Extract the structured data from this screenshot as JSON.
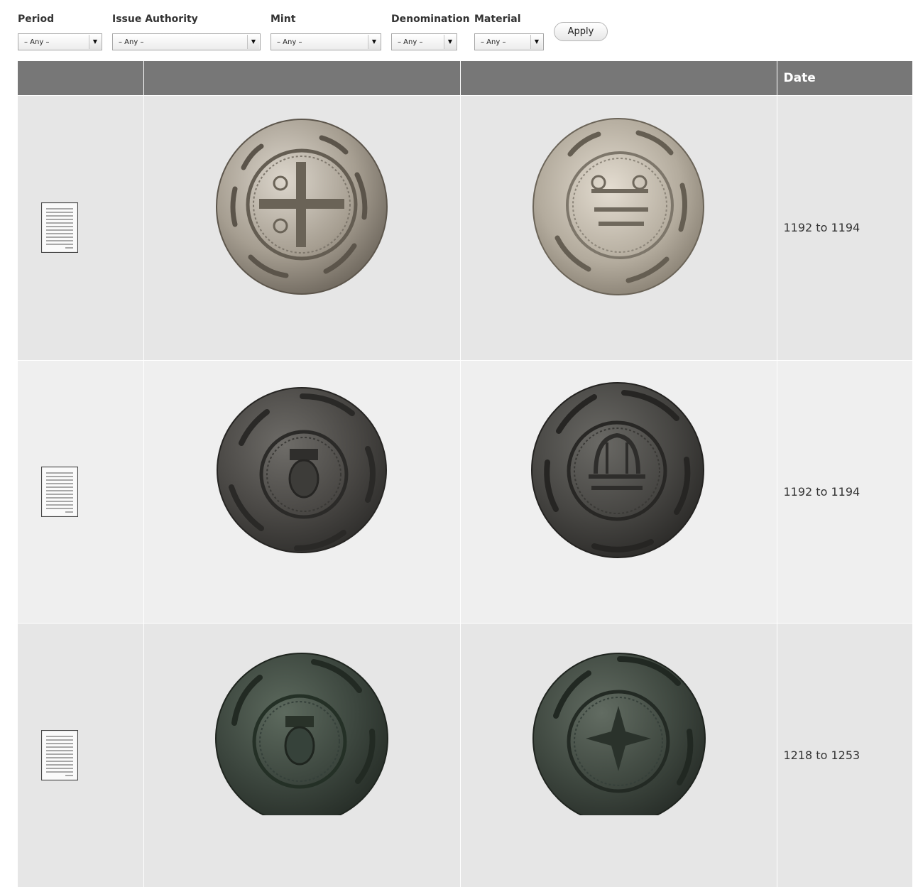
{
  "filters": {
    "period": {
      "label": "Period",
      "value": "– Any –"
    },
    "issue_authority": {
      "label": "Issue Authority",
      "value": "– Any –"
    },
    "mint": {
      "label": "Mint",
      "value": "– Any –"
    },
    "denomination": {
      "label": "Denomination",
      "value": "– Any –"
    },
    "material": {
      "label": "Material",
      "value": "– Any –"
    },
    "apply_label": "Apply"
  },
  "table": {
    "headers": [
      "",
      "",
      "",
      "Date"
    ],
    "rows": [
      {
        "date": "1192 to 1194",
        "coin_tone": "silver"
      },
      {
        "date": "1192 to 1194",
        "coin_tone": "dark-grey"
      },
      {
        "date": "1218 to 1253",
        "coin_tone": "dark-green"
      }
    ]
  },
  "icons": {
    "record": "document-icon",
    "dropdown": "chevron-down-icon"
  },
  "colors": {
    "header_bg": "#777777",
    "row_odd_bg": "#e6e6e6",
    "row_even_bg": "#efefef"
  }
}
